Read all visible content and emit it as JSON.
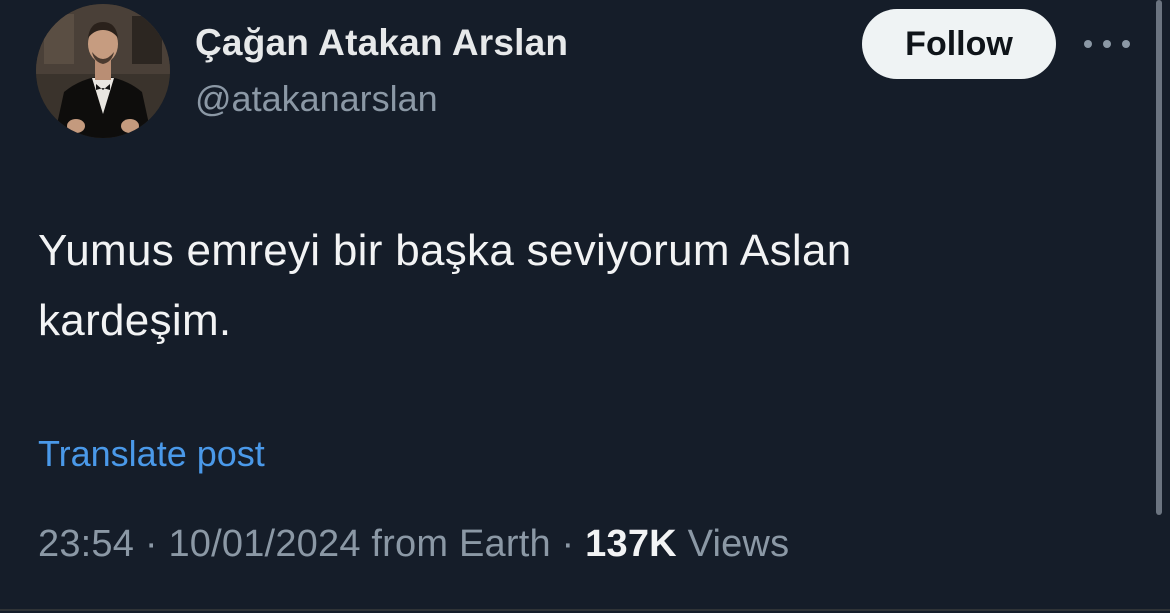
{
  "author": {
    "display_name": "Çağan Atakan Arslan",
    "handle": "@atakanarslan",
    "avatar_icon": "profile-photo"
  },
  "actions": {
    "follow_label": "Follow",
    "more_icon": "ellipsis-icon"
  },
  "post": {
    "text": "Yumus emreyi bir başka seviyorum Aslan kardeşim.",
    "translate_label": "Translate post"
  },
  "meta": {
    "time": "23:54",
    "separator1": " · ",
    "date": "10/01/2024",
    "source": " from Earth",
    "separator2": " · ",
    "views_count": "137K",
    "views_label": " Views"
  },
  "colors": {
    "background": "#151d29",
    "link": "#4a99e9",
    "muted": "#8b98a5",
    "button_bg": "#eff3f4"
  }
}
